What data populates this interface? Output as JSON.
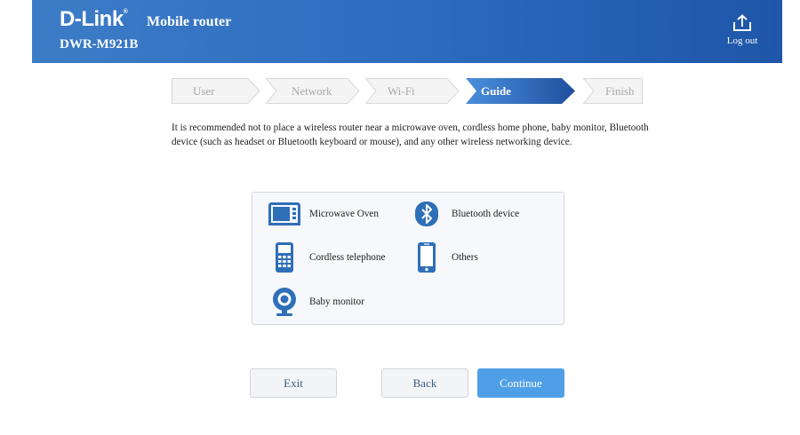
{
  "header": {
    "brand": "D-Link",
    "brand_reg": "®",
    "product": "Mobile router",
    "model": "DWR-M921B",
    "logout_label": "Log out"
  },
  "steps": [
    {
      "label": "User",
      "state": "inactive"
    },
    {
      "label": "Network",
      "state": "inactive"
    },
    {
      "label": "Wi-Fi",
      "state": "inactive"
    },
    {
      "label": "Guide",
      "state": "active"
    },
    {
      "label": "Finish",
      "state": "inactive"
    }
  ],
  "description": "It is recommended not to place a wireless router near a microwave oven, cordless home phone, baby monitor, Bluetooth device (such as headset or Bluetooth keyboard or mouse), and any other wireless networking device.",
  "devices": [
    {
      "label": "Microwave Oven",
      "icon": "microwave-icon"
    },
    {
      "label": "Bluetooth device",
      "icon": "bluetooth-icon"
    },
    {
      "label": "Cordless telephone",
      "icon": "cordless-phone-icon"
    },
    {
      "label": "Others",
      "icon": "smartphone-icon"
    },
    {
      "label": "Baby monitor",
      "icon": "webcam-icon"
    }
  ],
  "buttons": {
    "exit": "Exit",
    "back": "Back",
    "continue": "Continue"
  },
  "colors": {
    "header": "#2d6cc0",
    "accent": "#4f9fe6",
    "icon": "#2f6fb8",
    "active_step": "#2a6ac3"
  }
}
